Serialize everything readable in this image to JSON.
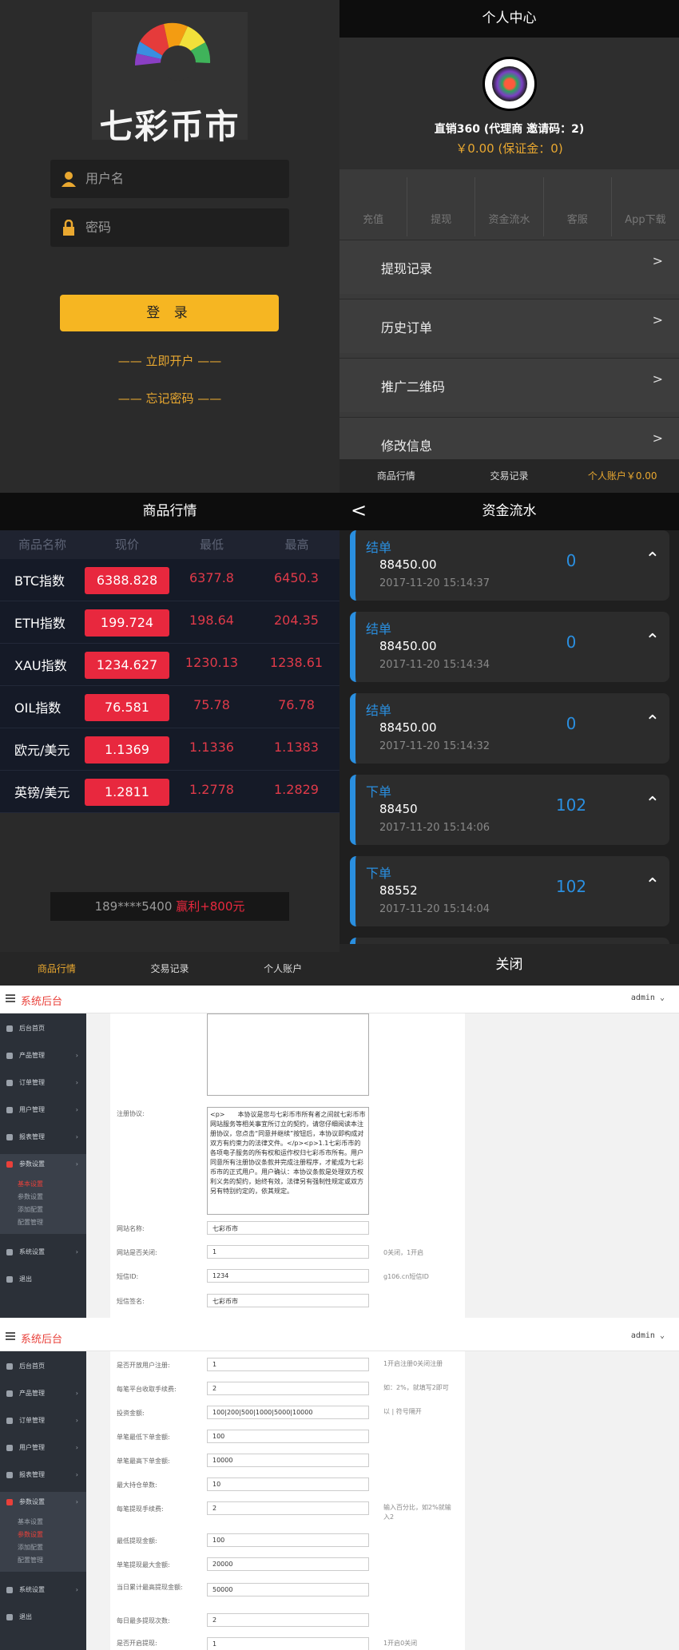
{
  "login": {
    "brand": "七彩币市",
    "username_placeholder": "用户名",
    "password_placeholder": "密码",
    "login_button": "登 录",
    "register_link": "—— 立即开户 ——",
    "forgot_link": "—— 忘记密码 ——"
  },
  "account": {
    "title": "个人中心",
    "user_line": "直销360 (代理商 邀请码：2)",
    "balance_line": "￥0.00 (保证金：0)",
    "quick_actions": [
      "充值",
      "提现",
      "资金流水",
      "客服",
      "App下载"
    ],
    "menu": [
      "提现记录",
      "历史订单",
      "推广二维码",
      "修改信息"
    ],
    "arrow": ">",
    "tabs": [
      "商品行情",
      "交易记录",
      "个人账户￥0.00"
    ]
  },
  "market": {
    "title": "商品行情",
    "headers": [
      "商品名称",
      "现价",
      "最低",
      "最高"
    ],
    "rows": [
      {
        "name": "BTC指数",
        "current": "6388.828",
        "low": "6377.8",
        "high": "6450.3"
      },
      {
        "name": "ETH指数",
        "current": "199.724",
        "low": "198.64",
        "high": "204.35"
      },
      {
        "name": "XAU指数",
        "current": "1234.627",
        "low": "1230.13",
        "high": "1238.61"
      },
      {
        "name": "OIL指数",
        "current": "76.581",
        "low": "75.78",
        "high": "76.78"
      },
      {
        "name": "欧元/美元",
        "current": "1.1369",
        "low": "1.1336",
        "high": "1.1383"
      },
      {
        "name": "英镑/美元",
        "current": "1.2811",
        "low": "1.2778",
        "high": "1.2829"
      }
    ],
    "ticker_user": "189****5400",
    "ticker_profit": "赢利+800元",
    "tabs": [
      "商品行情",
      "交易记录",
      "个人账户"
    ]
  },
  "flow": {
    "title": "资金流水",
    "back": "<",
    "close": "关闭",
    "cards": [
      {
        "type": "结单",
        "amount": "88450.00",
        "date": "2017-11-20 15:14:37",
        "value": "0"
      },
      {
        "type": "结单",
        "amount": "88450.00",
        "date": "2017-11-20 15:14:34",
        "value": "0"
      },
      {
        "type": "结单",
        "amount": "88450.00",
        "date": "2017-11-20 15:14:32",
        "value": "0"
      },
      {
        "type": "下单",
        "amount": "88450",
        "date": "2017-11-20 15:14:06",
        "value": "102"
      },
      {
        "type": "下单",
        "amount": "88552",
        "date": "2017-11-20 15:14:04",
        "value": "102"
      }
    ]
  },
  "admin": {
    "title": "系统后台",
    "user": "admin ⌄",
    "nav": [
      "后台首页",
      "产品管理",
      "订单管理",
      "用户管理",
      "报表管理",
      "参数设置",
      "系统设置",
      "退出"
    ],
    "sub_nav": [
      "基本设置",
      "参数设置",
      "添加配置",
      "配置管理"
    ],
    "panel1": {
      "agreement_label": "注册协议:",
      "agreement_text": "<p>　　本协议是您与七彩币市所有者之间就七彩币市网站服务等相关事宜所订立的契约，请您仔细阅读本注册协议，您点击“同意并继续”按钮后，本协议即构成对双方有约束力的法律文件。</p><p>1.1七彩币市的各项电子服务的所有权和运作权归七彩币市所有。用户同意所有注册协议条款并完成注册程序，才能成为七彩币市的正式用户。用户确认：本协议条款是处理双方权利义务的契约，始终有效，法律另有强制性规定或双方另有特别约定的，依其规定。",
      "fields": [
        {
          "label": "网站名称:",
          "value": "七彩币市",
          "hint": ""
        },
        {
          "label": "网站是否关闭:",
          "value": "1",
          "hint": "0关闭，1开启"
        },
        {
          "label": "短信ID:",
          "value": "1234",
          "hint": "g106.cn短信ID"
        },
        {
          "label": "短信签名:",
          "value": "七彩币市",
          "hint": ""
        }
      ]
    },
    "panel2": {
      "fields": [
        {
          "label": "是否开放用户注册:",
          "value": "1",
          "hint": "1开启注册0关闭注册"
        },
        {
          "label": "每笔平台收取手续费:",
          "value": "2",
          "hint": "如：2%，就填写2即可"
        },
        {
          "label": "投资金额:",
          "value": "100|200|500|1000|5000|10000",
          "hint": "以 | 符号隔开"
        },
        {
          "label": "单笔最低下单金额:",
          "value": "100",
          "hint": ""
        },
        {
          "label": "单笔最高下单金额:",
          "value": "10000",
          "hint": ""
        },
        {
          "label": "最大持仓单数:",
          "value": "10",
          "hint": ""
        },
        {
          "label": "每笔提现手续费:",
          "value": "2",
          "hint": "输入百分比，如2%就输入2"
        },
        {
          "label": "最低提现金额:",
          "value": "100",
          "hint": ""
        },
        {
          "label": "单笔提现最大金额:",
          "value": "20000",
          "hint": ""
        },
        {
          "label": "当日累计最高提现金额:",
          "value": "50000",
          "hint": ""
        },
        {
          "label": "每日最多提现次数:",
          "value": "2",
          "hint": ""
        },
        {
          "label": "是否开启提现:",
          "value": "1",
          "hint": "1开启0关闭"
        }
      ]
    }
  },
  "colors": {
    "gold": "#f6b622",
    "red": "#e8283e",
    "blue": "#2a8fe0",
    "admin_red": "#e9403a"
  }
}
